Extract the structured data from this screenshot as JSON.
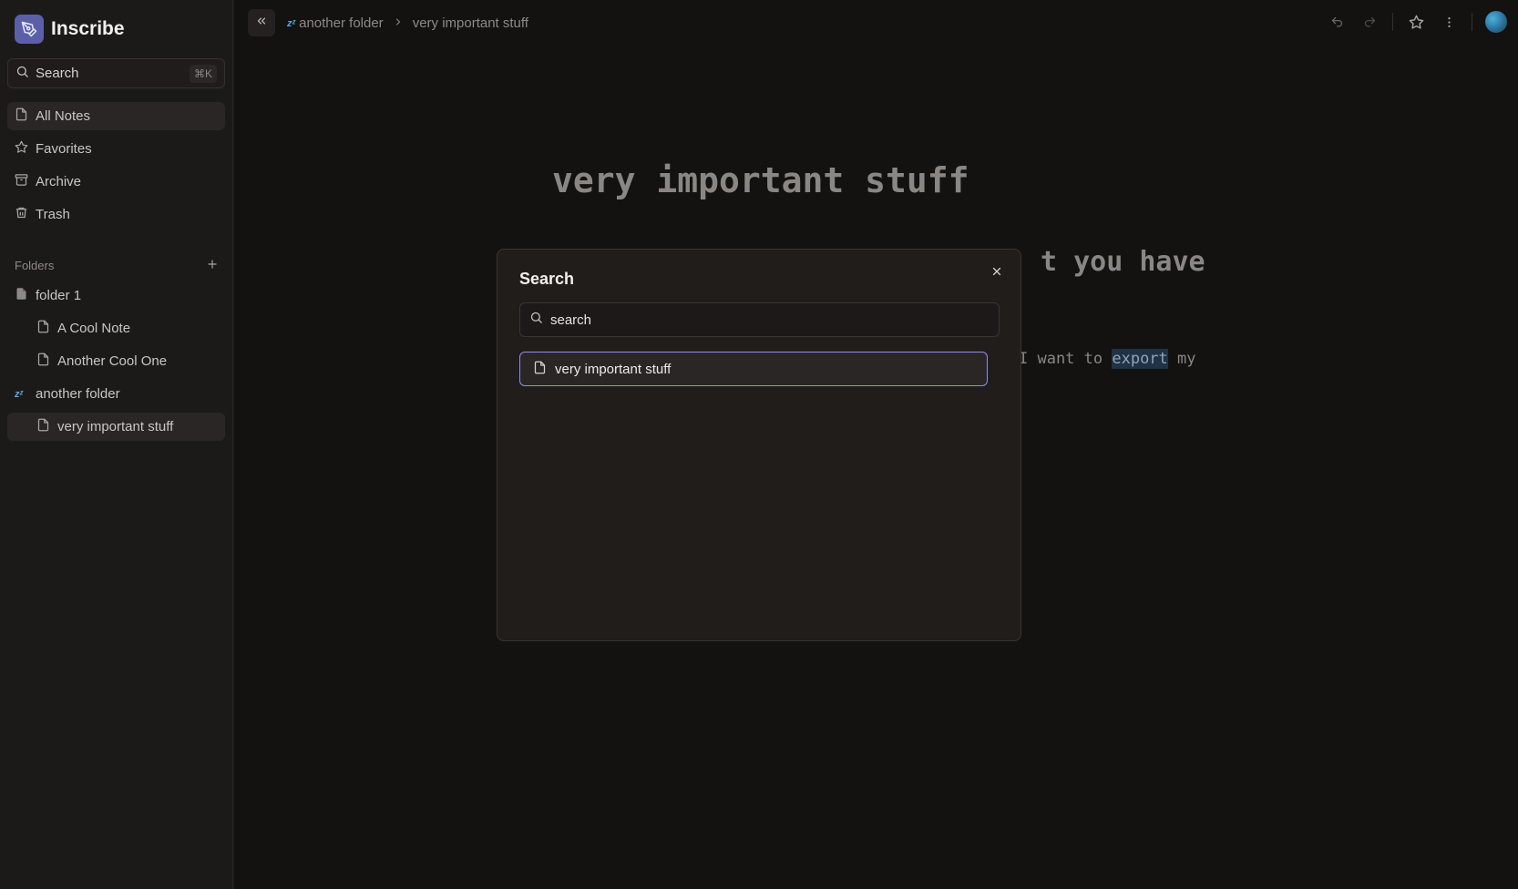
{
  "app": {
    "name": "Inscribe"
  },
  "sidebar": {
    "search": {
      "label": "Search",
      "shortcut": "⌘K"
    },
    "nav": [
      {
        "label": "All Notes",
        "icon": "file-icon",
        "active": true
      },
      {
        "label": "Favorites",
        "icon": "star-icon"
      },
      {
        "label": "Archive",
        "icon": "archive-icon"
      },
      {
        "label": "Trash",
        "icon": "trash-icon"
      }
    ],
    "folders_label": "Folders",
    "tree": [
      {
        "label": "folder 1",
        "icon": "filled-file-icon"
      },
      {
        "label": "A Cool Note",
        "icon": "file-icon",
        "child": true
      },
      {
        "label": "Another Cool One",
        "icon": "file-icon",
        "child": true
      },
      {
        "label": "another folder",
        "icon": "zzz-emoji-icon"
      },
      {
        "label": "very important stuff",
        "icon": "file-icon",
        "child": true,
        "active": true
      }
    ]
  },
  "breadcrumb": {
    "folder": "another folder",
    "folder_icon": "zzz-emoji-icon",
    "page": "very important stuff"
  },
  "document": {
    "title": "very important stuff",
    "heading_fragment": "t you have",
    "para_before": "I want to ",
    "para_highlight": "export",
    "para_after": " my"
  },
  "search_modal": {
    "title": "Search",
    "input_value": "search",
    "results": [
      {
        "label": "very important stuff",
        "icon": "file-icon"
      }
    ]
  },
  "colors": {
    "accent": "#8f8cf0",
    "brand": "#5b5fa8",
    "highlight": "#1f3345"
  }
}
